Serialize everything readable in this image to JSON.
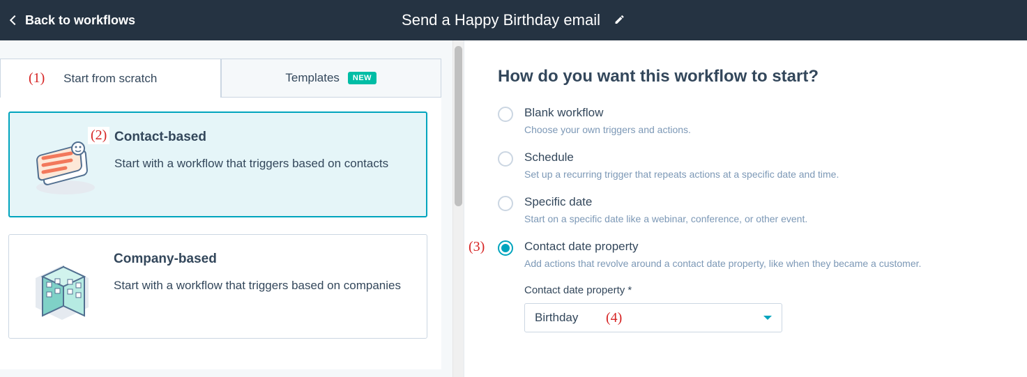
{
  "header": {
    "back_label": "Back to workflows",
    "title": "Send a Happy Birthday email"
  },
  "tabs": {
    "scratch": "Start from scratch",
    "templates": "Templates",
    "new_badge": "NEW"
  },
  "cards": {
    "contact": {
      "title": "Contact-based",
      "desc": "Start with a workflow that triggers based on contacts"
    },
    "company": {
      "title": "Company-based",
      "desc": "Start with a workflow that triggers based on companies"
    }
  },
  "right": {
    "heading": "How do you want this workflow to start?",
    "options": {
      "blank": {
        "title": "Blank workflow",
        "desc": "Choose your own triggers and actions."
      },
      "schedule": {
        "title": "Schedule",
        "desc": "Set up a recurring trigger that repeats actions at a specific date and time."
      },
      "specific": {
        "title": "Specific date",
        "desc": "Start on a specific date like a webinar, conference, or other event."
      },
      "contactdate": {
        "title": "Contact date property",
        "desc": "Add actions that revolve around a contact date property, like when they became a customer."
      }
    },
    "field_label": "Contact date property *",
    "field_value": "Birthday"
  },
  "annotations": {
    "a1": "(1)",
    "a2": "(2)",
    "a3": "(3)",
    "a4": "(4)"
  }
}
